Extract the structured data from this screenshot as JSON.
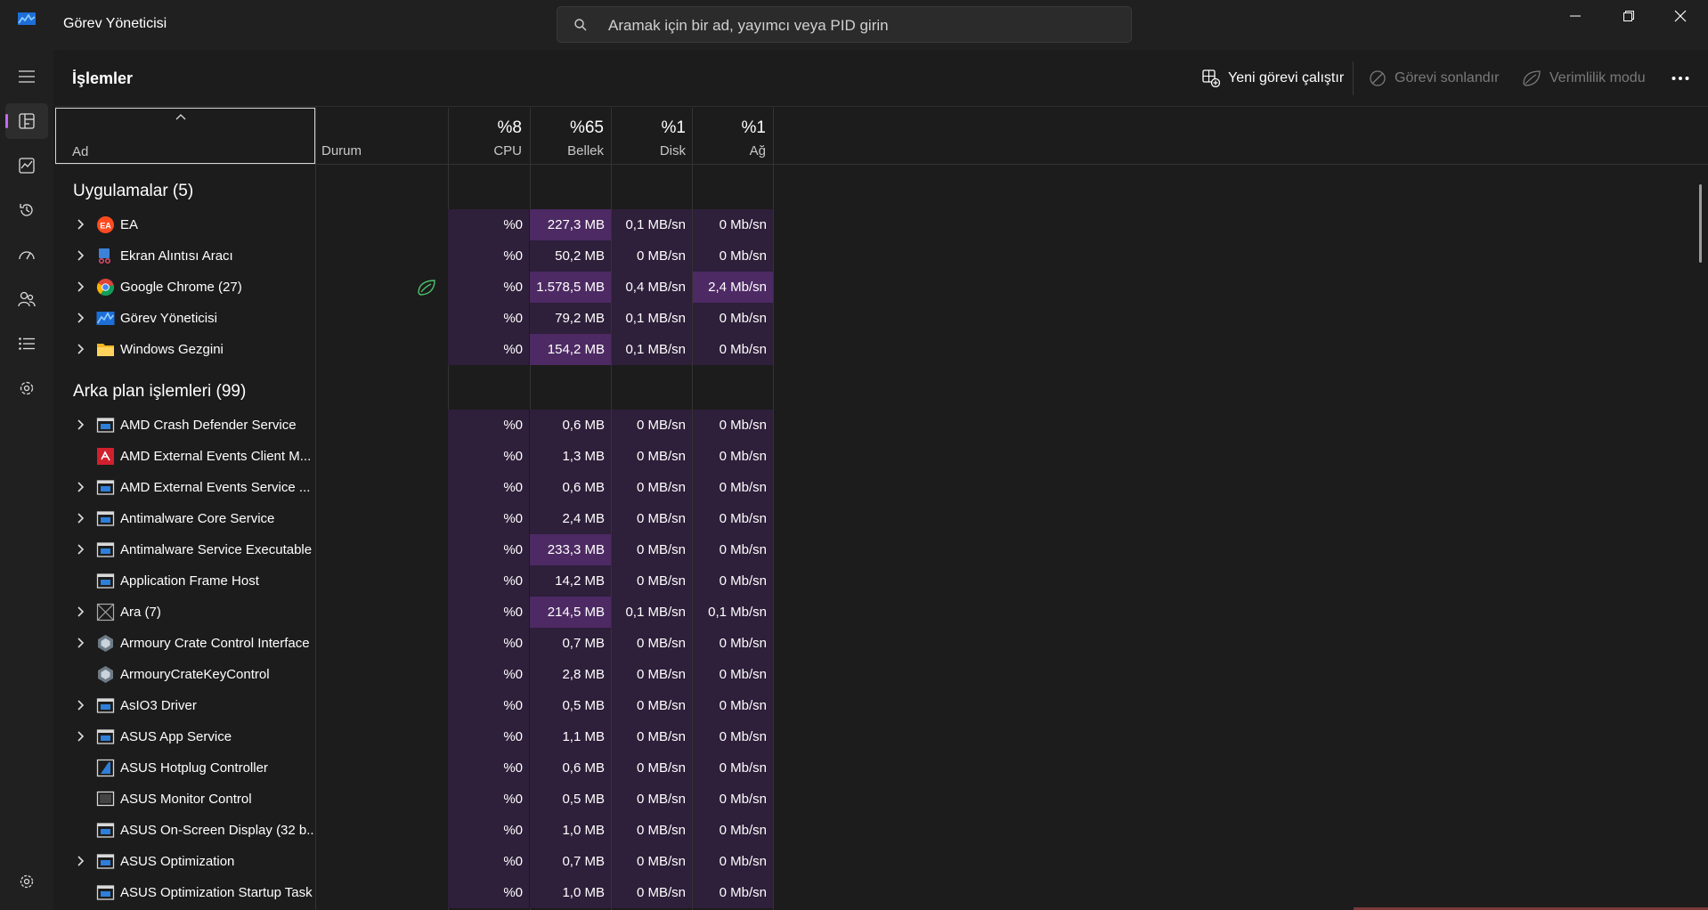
{
  "app": {
    "title": "Görev Yöneticisi",
    "search_placeholder": "Aramak için bir ad, yayımcı veya PID girin",
    "accent": "#c36bf0"
  },
  "rail": {
    "items": [
      "hamburger-menu-icon",
      "processes-icon",
      "performance-icon",
      "app-history-icon",
      "startup-apps-icon",
      "users-icon",
      "details-icon",
      "services-icon",
      "settings-icon"
    ],
    "active": "processes-icon"
  },
  "page": {
    "title": "İşlemler",
    "commands": {
      "run_new": "Yeni görevi çalıştır",
      "end_task": "Görevi sonlandır",
      "efficiency": "Verimlilik modu"
    }
  },
  "columns": {
    "name": "Ad",
    "status": "Durum",
    "cpu": {
      "pct": "%8",
      "label": "CPU"
    },
    "mem": {
      "pct": "%65",
      "label": "Bellek"
    },
    "disk": {
      "pct": "%1",
      "label": "Disk"
    },
    "net": {
      "pct": "%1",
      "label": "Ağ"
    }
  },
  "groups": [
    {
      "title": "Uygulamalar (5)",
      "rows": [
        {
          "name": "EA",
          "expand": true,
          "icon": "ea-icon",
          "cpu": "%0",
          "mem": "227,3 MB",
          "disk": "0,1 MB/sn",
          "net": "0 Mb/sn",
          "mem_hl": 2,
          "net_hl": 1
        },
        {
          "name": "Ekran Alıntısı Aracı",
          "expand": true,
          "icon": "snipping-tool-icon",
          "cpu": "%0",
          "mem": "50,2 MB",
          "disk": "0 MB/sn",
          "net": "0 Mb/sn",
          "mem_hl": 1,
          "net_hl": 1
        },
        {
          "name": "Google Chrome (27)",
          "expand": true,
          "icon": "chrome-icon",
          "eco": true,
          "cpu": "%0",
          "mem": "1.578,5 MB",
          "disk": "0,4 MB/sn",
          "net": "2,4 Mb/sn",
          "mem_hl": 2,
          "net_hl": 2
        },
        {
          "name": "Görev Yöneticisi",
          "expand": true,
          "icon": "task-manager-icon",
          "cpu": "%0",
          "mem": "79,2 MB",
          "disk": "0,1 MB/sn",
          "net": "0 Mb/sn",
          "mem_hl": 1,
          "net_hl": 1
        },
        {
          "name": "Windows Gezgini",
          "expand": true,
          "icon": "folder-icon",
          "cpu": "%0",
          "mem": "154,2 MB",
          "disk": "0,1 MB/sn",
          "net": "0 Mb/sn",
          "mem_hl": 2,
          "net_hl": 1
        }
      ]
    },
    {
      "title": "Arka plan işlemleri (99)",
      "rows": [
        {
          "name": "AMD Crash Defender Service",
          "expand": true,
          "icon": "service-icon",
          "cpu": "%0",
          "mem": "0,6 MB",
          "disk": "0 MB/sn",
          "net": "0 Mb/sn",
          "mem_hl": 1,
          "net_hl": 1
        },
        {
          "name": "AMD External Events Client M...",
          "expand": false,
          "icon": "amd-icon",
          "cpu": "%0",
          "mem": "1,3 MB",
          "disk": "0 MB/sn",
          "net": "0 Mb/sn",
          "mem_hl": 1,
          "net_hl": 1
        },
        {
          "name": "AMD External Events Service ...",
          "expand": true,
          "icon": "service-icon",
          "cpu": "%0",
          "mem": "0,6 MB",
          "disk": "0 MB/sn",
          "net": "0 Mb/sn",
          "mem_hl": 1,
          "net_hl": 1
        },
        {
          "name": "Antimalware Core Service",
          "expand": true,
          "icon": "service-icon",
          "cpu": "%0",
          "mem": "2,4 MB",
          "disk": "0 MB/sn",
          "net": "0 Mb/sn",
          "mem_hl": 1,
          "net_hl": 1
        },
        {
          "name": "Antimalware Service Executable",
          "expand": true,
          "icon": "service-icon",
          "cpu": "%0",
          "mem": "233,3 MB",
          "disk": "0 MB/sn",
          "net": "0 Mb/sn",
          "mem_hl": 2,
          "net_hl": 1
        },
        {
          "name": "Application Frame Host",
          "expand": false,
          "icon": "service-icon",
          "cpu": "%0",
          "mem": "14,2 MB",
          "disk": "0 MB/sn",
          "net": "0 Mb/sn",
          "mem_hl": 1,
          "net_hl": 1
        },
        {
          "name": "Ara (7)",
          "expand": true,
          "icon": "search-app-icon",
          "cpu": "%0",
          "mem": "214,5 MB",
          "disk": "0,1 MB/sn",
          "net": "0,1 Mb/sn",
          "mem_hl": 2,
          "net_hl": 1
        },
        {
          "name": "Armoury Crate Control Interface",
          "expand": true,
          "icon": "armoury-icon",
          "cpu": "%0",
          "mem": "0,7 MB",
          "disk": "0 MB/sn",
          "net": "0 Mb/sn",
          "mem_hl": 1,
          "net_hl": 1
        },
        {
          "name": "ArmouryCrateKeyControl",
          "expand": false,
          "icon": "armoury-icon",
          "cpu": "%0",
          "mem": "2,8 MB",
          "disk": "0 MB/sn",
          "net": "0 Mb/sn",
          "mem_hl": 1,
          "net_hl": 1
        },
        {
          "name": "AsIO3 Driver",
          "expand": true,
          "icon": "service-icon",
          "cpu": "%0",
          "mem": "0,5 MB",
          "disk": "0 MB/sn",
          "net": "0 Mb/sn",
          "mem_hl": 1,
          "net_hl": 1
        },
        {
          "name": "ASUS App Service",
          "expand": true,
          "icon": "service-icon",
          "cpu": "%0",
          "mem": "1,1 MB",
          "disk": "0 MB/sn",
          "net": "0 Mb/sn",
          "mem_hl": 1,
          "net_hl": 1
        },
        {
          "name": "ASUS Hotplug Controller",
          "expand": false,
          "icon": "asus-hotplug-icon",
          "cpu": "%0",
          "mem": "0,6 MB",
          "disk": "0 MB/sn",
          "net": "0 Mb/sn",
          "mem_hl": 1,
          "net_hl": 1
        },
        {
          "name": "ASUS Monitor Control",
          "expand": false,
          "icon": "monitor-icon",
          "cpu": "%0",
          "mem": "0,5 MB",
          "disk": "0 MB/sn",
          "net": "0 Mb/sn",
          "mem_hl": 1,
          "net_hl": 1
        },
        {
          "name": "ASUS On-Screen Display (32 b...",
          "expand": false,
          "icon": "service-icon",
          "cpu": "%0",
          "mem": "1,0 MB",
          "disk": "0 MB/sn",
          "net": "0 Mb/sn",
          "mem_hl": 1,
          "net_hl": 1
        },
        {
          "name": "ASUS Optimization",
          "expand": true,
          "icon": "service-icon",
          "cpu": "%0",
          "mem": "0,7 MB",
          "disk": "0 MB/sn",
          "net": "0 Mb/sn",
          "mem_hl": 1,
          "net_hl": 1
        },
        {
          "name": "ASUS Optimization Startup Task",
          "expand": false,
          "icon": "service-icon",
          "cpu": "%0",
          "mem": "1,0 MB",
          "disk": "0 MB/sn",
          "net": "0 Mb/sn",
          "mem_hl": 1,
          "net_hl": 1
        }
      ]
    }
  ]
}
